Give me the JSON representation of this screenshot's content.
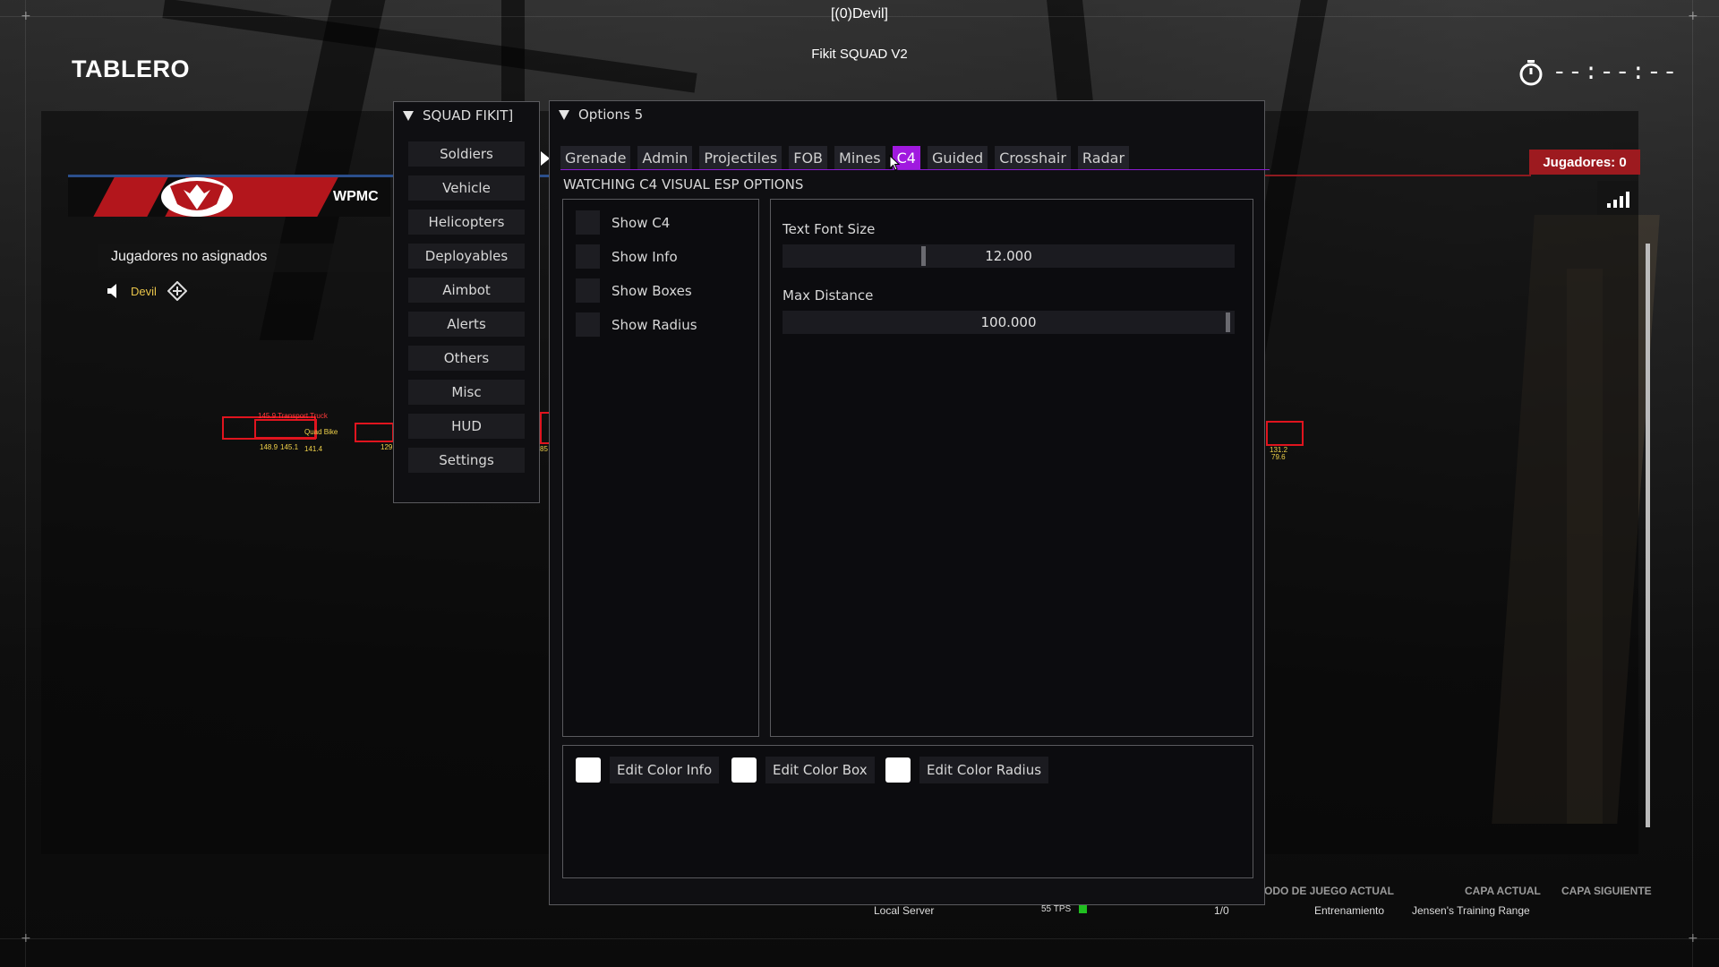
{
  "game": {
    "title": "TABLERO",
    "player_tag": "[(0)Devil]",
    "cheat_title": "Fikit SQUAD V2",
    "timer": "--:--:--",
    "team_name": "WPMC",
    "unassigned_label": "Jugadores no asignados",
    "player_name": "Devil",
    "players_count": "Jugadores: 0",
    "esp_labels": {
      "a1": "145.9  Transport Truck",
      "a2": "Quad Bike",
      "a3": "148.9",
      "a4": "145.1",
      "a5": "141.4",
      "b1": "129",
      "c1": "85",
      "d1": "131.2",
      "d2": "79.6"
    },
    "footer": {
      "server": "Local Server",
      "tps": "55 TPS",
      "slots": "1/0",
      "mode_header": "ODO DE JUEGO ACTUAL",
      "mode_value": "Entrenamiento",
      "layer_header": "CAPA ACTUAL",
      "layer_value": "Jensen's Training Range",
      "next_header": "CAPA SIGUIENTE"
    },
    "colors": {
      "team_red": "#b3161c",
      "badge": "#9d1a1f",
      "team_blue_line": "#2b4f8c",
      "tps_indicator": "#20c020"
    }
  },
  "menu": {
    "title": "SQUAD FIKIT]",
    "items": [
      "Soldiers",
      "Vehicle",
      "Helicopters",
      "Deployables",
      "Aimbot",
      "Alerts",
      "Others",
      "Misc",
      "HUD",
      "Settings"
    ]
  },
  "options": {
    "title": "Options 5",
    "tabs": [
      "Grenade",
      "Admin",
      "Projectiles",
      "FOB",
      "Mines",
      "C4",
      "Guided",
      "Crosshair",
      "Radar"
    ],
    "active_tab": "C4",
    "section_title": "WATCHING C4 VISUAL ESP OPTIONS",
    "checkboxes": [
      "Show C4",
      "Show Info",
      "Show Boxes",
      "Show Radius"
    ],
    "sliders": [
      {
        "label": "Text Font Size",
        "value": "12.000",
        "fraction": 0.31
      },
      {
        "label": "Max Distance",
        "value": "100.000",
        "fraction": 0.99
      }
    ],
    "color_buttons": [
      "Edit Color Info",
      "Edit Color Box",
      "Edit Color Radius"
    ],
    "colors": {
      "accent": "#a019df",
      "swatch": "#ffffff"
    }
  }
}
